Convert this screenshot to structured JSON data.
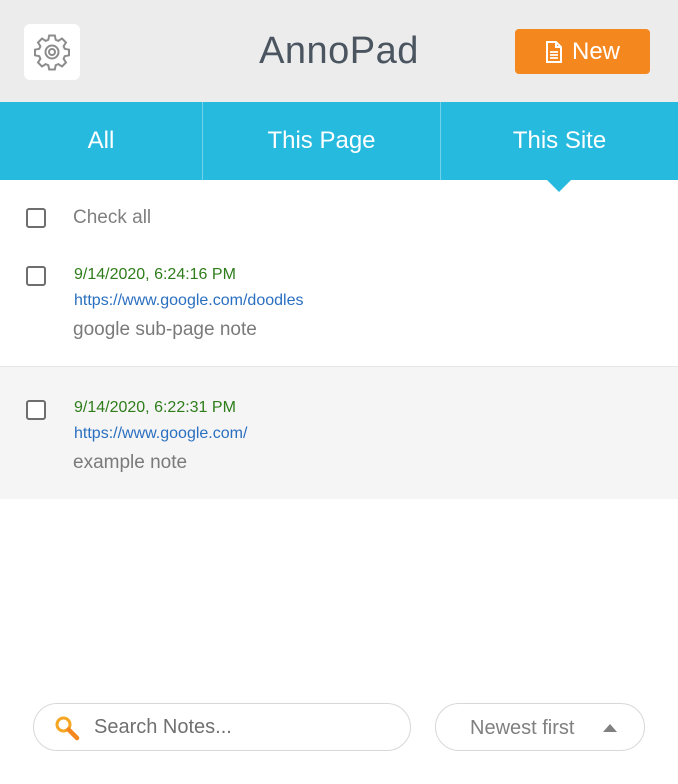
{
  "app": {
    "title": "AnnoPad",
    "new_button_label": "New",
    "accent_color": "#26badf",
    "new_button_color": "#f5871f"
  },
  "header": {
    "settings_icon": "gear-icon",
    "new_icon": "document-icon"
  },
  "tabs": [
    {
      "label": "All",
      "active": false
    },
    {
      "label": "This Page",
      "active": false
    },
    {
      "label": "This Site",
      "active": true
    }
  ],
  "list": {
    "check_all_label": "Check all",
    "check_all_checked": false,
    "notes": [
      {
        "date": "9/14/2020, 6:24:16 PM",
        "url": "https://www.google.com/doodles",
        "text": "google sub-page note",
        "checked": false
      },
      {
        "date": "9/14/2020, 6:22:31 PM",
        "url": "https://www.google.com/",
        "text": "example note",
        "checked": false
      }
    ]
  },
  "footer": {
    "search_placeholder": "Search Notes...",
    "search_value": "",
    "search_icon": "magnifier-icon",
    "sort_label": "Newest first",
    "sort_icon": "caret-up-icon"
  }
}
